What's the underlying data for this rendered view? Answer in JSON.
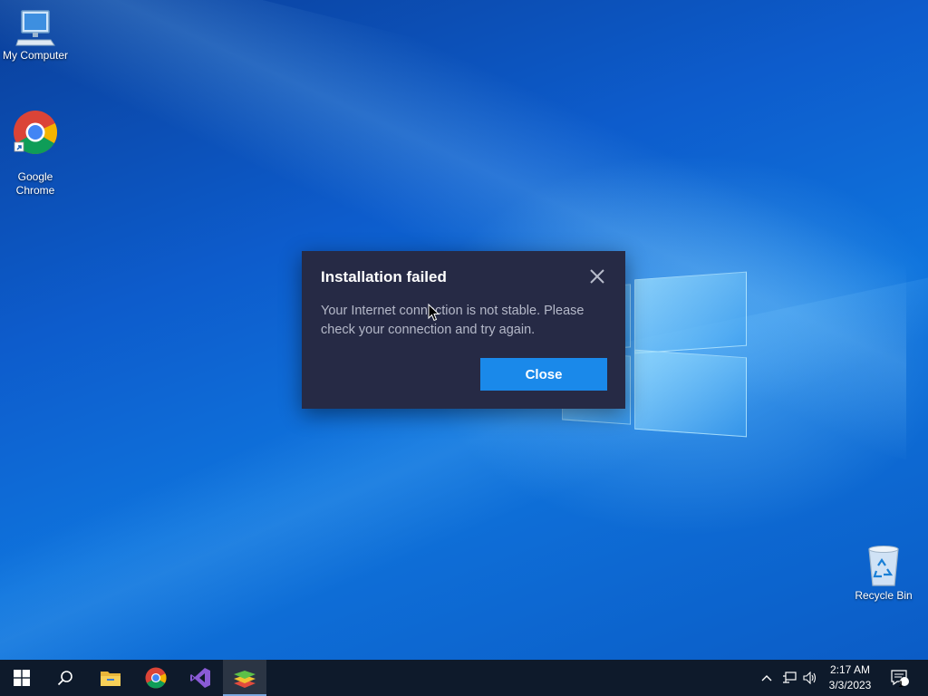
{
  "desktop": {
    "icons": [
      {
        "label": "My Computer",
        "icon": "computer-icon"
      },
      {
        "label": "Google\nChrome",
        "icon": "chrome-icon"
      },
      {
        "label": "Recycle Bin",
        "icon": "recycle-bin-icon"
      }
    ]
  },
  "dialog": {
    "title": "Installation failed",
    "message": "Your Internet connection is not stable. Please check your connection and try again.",
    "close_button_label": "Close",
    "close_icon": "close-icon"
  },
  "taskbar": {
    "apps": [
      {
        "name": "Start",
        "icon": "windows-start-icon"
      },
      {
        "name": "Search",
        "icon": "search-icon"
      },
      {
        "name": "File Explorer",
        "icon": "folder-icon"
      },
      {
        "name": "Google Chrome",
        "icon": "chrome-icon"
      },
      {
        "name": "Visual Studio",
        "icon": "visual-studio-icon"
      },
      {
        "name": "BlueStacks",
        "icon": "bluestacks-icon",
        "active": true
      }
    ],
    "tray": {
      "time": "2:17 AM",
      "date": "3/3/2023",
      "notification_count": "1"
    }
  },
  "colors": {
    "dialog_bg": "#262a45",
    "accent": "#1a89ea",
    "taskbar_bg": "#0e1a2b"
  }
}
